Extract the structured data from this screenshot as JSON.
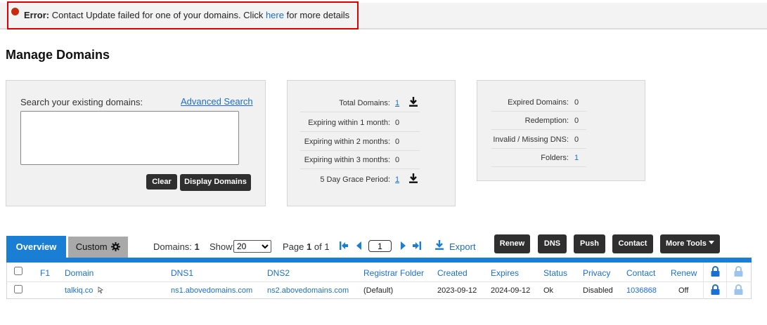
{
  "error": {
    "prefix": "Error:",
    "message": " Contact Update failed for one of your domains. Click ",
    "link": "here",
    "suffix": " for more details"
  },
  "page_title": "Manage Domains",
  "search": {
    "label": "Search your existing domains:",
    "advanced_link": "Advanced Search",
    "value": "",
    "clear_label": "Clear",
    "display_label": "Display Domains"
  },
  "stats_left": {
    "total_label": "Total Domains:",
    "total_value": "1",
    "exp1_label": "Expiring within 1 month:",
    "exp1_value": "0",
    "exp2_label": "Expiring within 2 months:",
    "exp2_value": "0",
    "exp3_label": "Expiring within 3 months:",
    "exp3_value": "0",
    "grace_label": "5 Day Grace Period:",
    "grace_value": "1"
  },
  "stats_right": {
    "expired_label": "Expired Domains:",
    "expired_value": "0",
    "redemption_label": "Redemption:",
    "redemption_value": "0",
    "invalid_label": "Invalid / Missing DNS:",
    "invalid_value": "0",
    "folders_label": "Folders:",
    "folders_value": "1"
  },
  "tabs": {
    "overview": "Overview",
    "custom": "Custom"
  },
  "toolbar": {
    "domains_label": "Domains:",
    "domains_count": "1",
    "show_label": "Show:",
    "show_value": "20",
    "page_label": "Page",
    "page_current": "1",
    "page_of": "of 1",
    "page_input": "1",
    "export_label": "Export",
    "renew_label": "Renew",
    "dns_label": "DNS",
    "push_label": "Push",
    "contact_label": "Contact",
    "more_tools_label": "More Tools"
  },
  "table": {
    "headers": {
      "f1": "F1",
      "domain": "Domain",
      "dns1": "DNS1",
      "dns2": "DNS2",
      "registrar_folder": "Registrar Folder",
      "created": "Created",
      "expires": "Expires",
      "status": "Status",
      "privacy": "Privacy",
      "contact": "Contact",
      "renew": "Renew"
    },
    "rows": [
      {
        "domain": "talkiq.co",
        "dns1": "ns1.abovedomains.com",
        "dns2": "ns2.abovedomains.com",
        "registrar_folder": "(Default)",
        "created": "2023-09-12",
        "expires": "2024-09-12",
        "status": "Ok",
        "privacy": "Disabled",
        "contact": "1036868",
        "renew": "Off"
      }
    ]
  },
  "colors": {
    "accent": "#1a7fd4",
    "link": "#1a6fd0",
    "error_border": "#e00000",
    "error_dot": "#c72a0e",
    "dark_button": "#2f2f2f"
  }
}
